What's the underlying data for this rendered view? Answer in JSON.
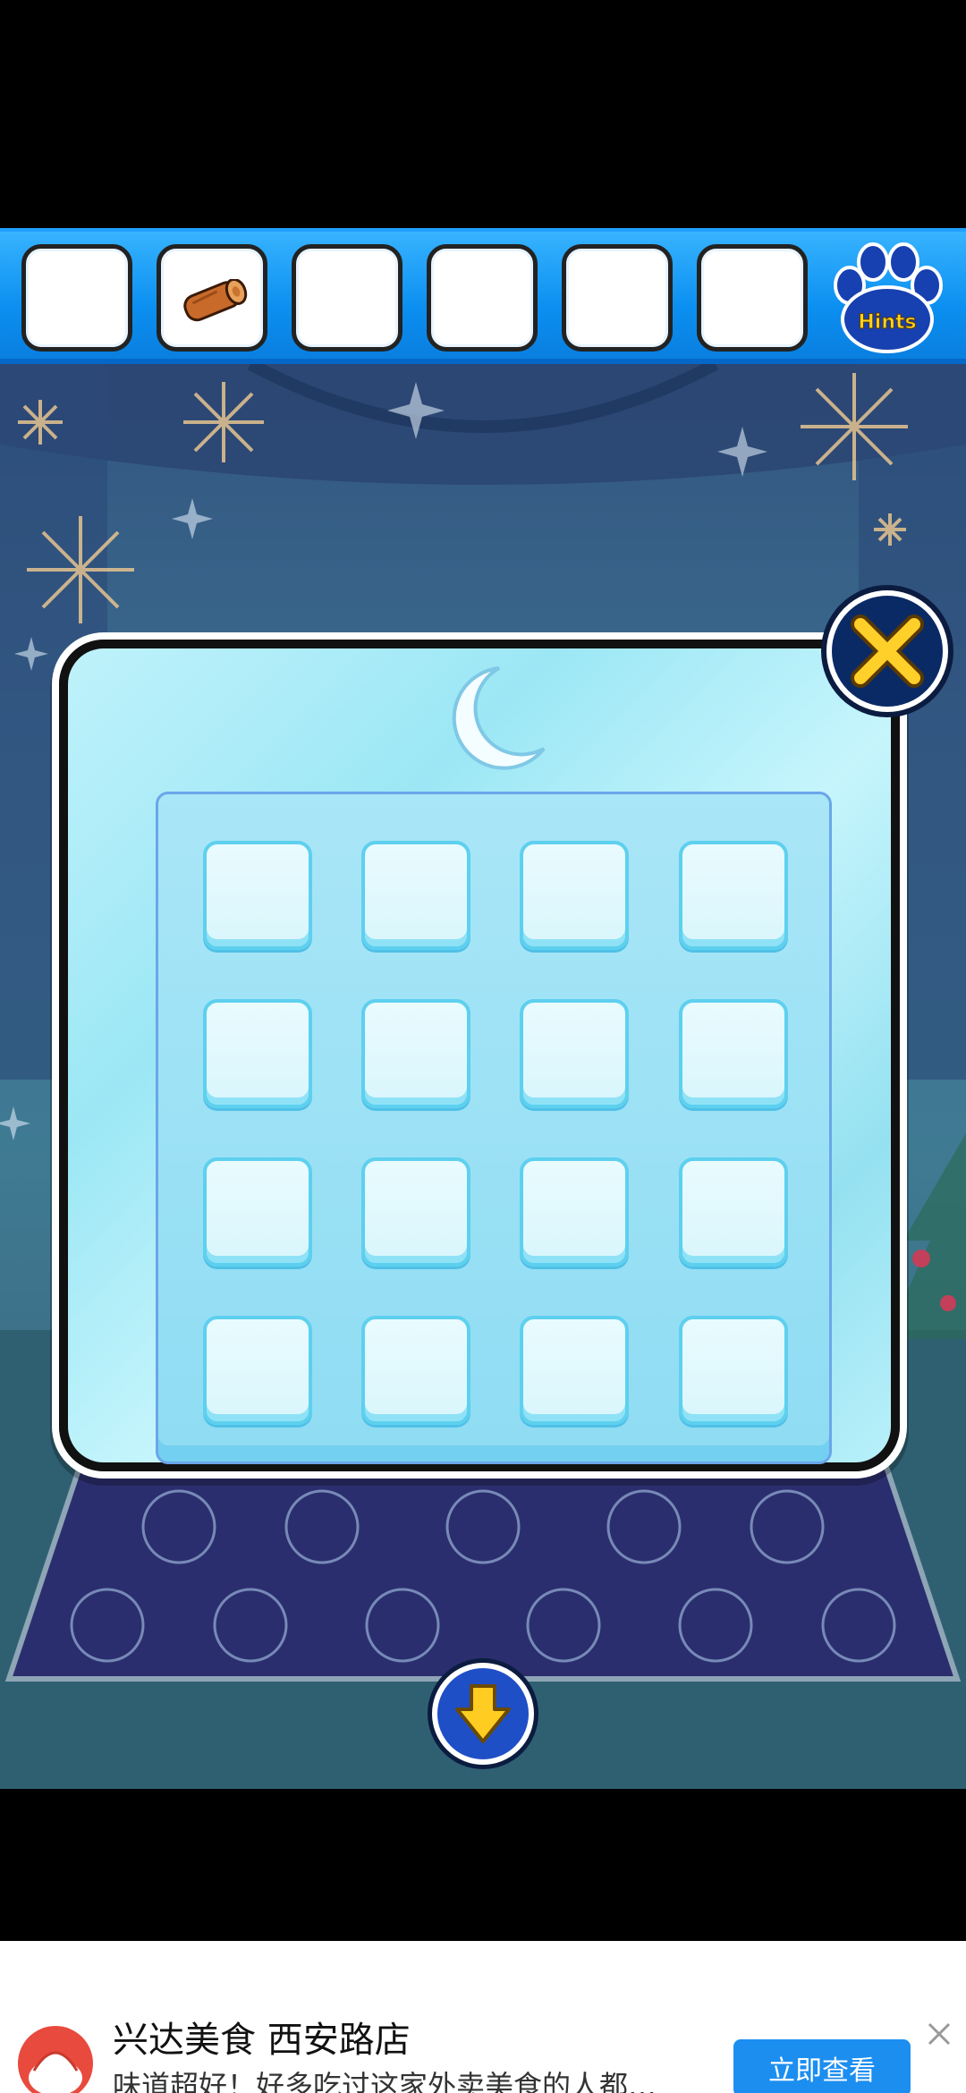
{
  "inventory": {
    "slots": [
      "empty",
      "wooden-log",
      "empty",
      "empty",
      "empty",
      "empty"
    ],
    "hints_label": "Hints"
  },
  "puzzle": {
    "symbol": "crescent-moon",
    "grid_rows": 4,
    "grid_cols": 4
  },
  "controls": {
    "close_icon": "close-x-icon",
    "down_icon": "down-arrow-icon"
  },
  "ad": {
    "title": "兴达美食 西安路店",
    "subtitle": "味道超好！好多吃过这家外卖美食的人都…",
    "cta": "立即查看"
  },
  "colors": {
    "inventory_bar": "#0b8ff0",
    "panel": "#bff2fb",
    "tile": "#e9fbfe",
    "close_button": "#0a2a66",
    "ad_cta": "#1c8ef0"
  }
}
